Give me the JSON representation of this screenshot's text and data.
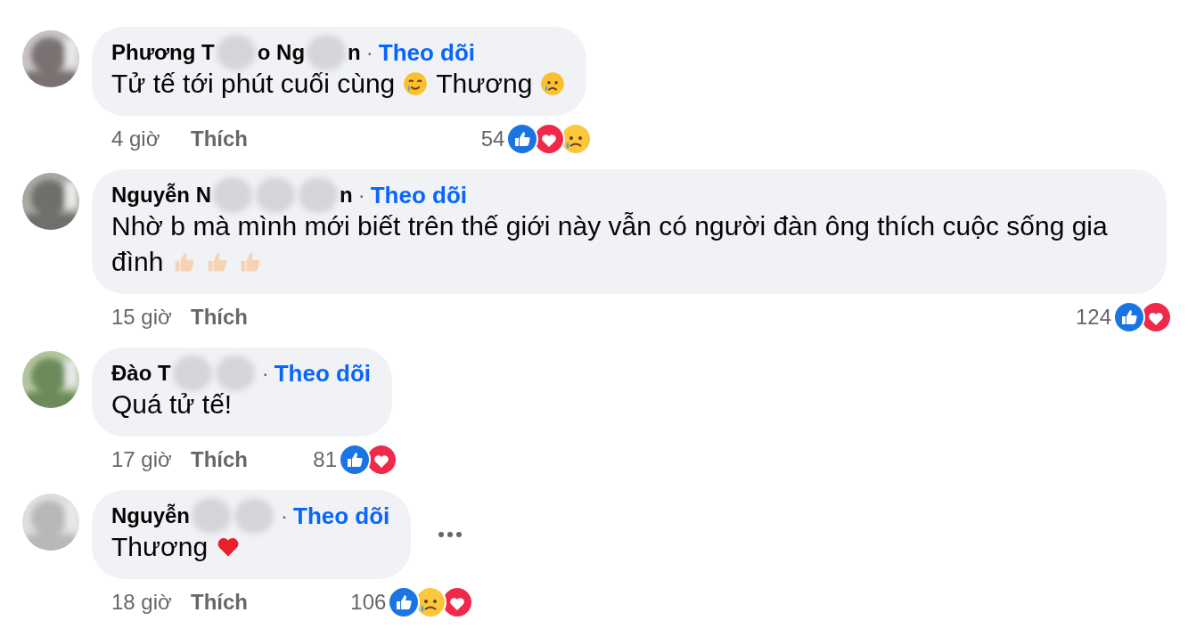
{
  "comments": [
    {
      "name": [
        {
          "kind": "text",
          "text": "Phương T"
        },
        {
          "kind": "blur"
        },
        {
          "kind": "text",
          "text": "o Ng"
        },
        {
          "kind": "blur"
        },
        {
          "kind": "text",
          "text": "n"
        }
      ],
      "separator": "·",
      "follow": "Theo dõi",
      "body": [
        {
          "kind": "text",
          "text": "Tử tế tới phút cuối cùng"
        },
        {
          "kind": "tear-smile"
        },
        {
          "kind": "text",
          "text": "Thương"
        },
        {
          "kind": "sad-tear"
        }
      ],
      "time": "4 giờ",
      "like": "Thích",
      "count": "54",
      "reactions": [
        {
          "kind": "like"
        },
        {
          "kind": "love"
        },
        {
          "kind": "sad"
        }
      ],
      "more": false
    },
    {
      "name": [
        {
          "kind": "text",
          "text": "Nguyễn N"
        },
        {
          "kind": "blur"
        },
        {
          "kind": "blur"
        },
        {
          "kind": "blur"
        },
        {
          "kind": "text",
          "text": "n"
        }
      ],
      "separator": "·",
      "follow": "Theo dõi",
      "body": [
        {
          "kind": "text",
          "text": "Nhờ b mà mình mới biết trên thế giới này vẫn có người đàn ông thích cuộc sống gia"
        },
        {
          "kind": "text",
          "text": "đình"
        },
        {
          "kind": "thumbs"
        },
        {
          "kind": "thumbs"
        },
        {
          "kind": "thumbs"
        }
      ],
      "time": "15 giờ",
      "like": "Thích",
      "count": "124",
      "reactions": [
        {
          "kind": "like"
        },
        {
          "kind": "love"
        }
      ],
      "more": false
    },
    {
      "name": [
        {
          "kind": "text",
          "text": "Đào T"
        },
        {
          "kind": "blur"
        },
        {
          "kind": "blur"
        }
      ],
      "separator": "·",
      "follow": "Theo dõi",
      "body": [
        {
          "kind": "text",
          "text": "Quá tử tế!"
        }
      ],
      "time": "17 giờ",
      "like": "Thích",
      "count": "81",
      "reactions": [
        {
          "kind": "like"
        },
        {
          "kind": "love"
        }
      ],
      "more": false
    },
    {
      "name": [
        {
          "kind": "text",
          "text": "Nguyễn"
        },
        {
          "kind": "blur"
        },
        {
          "kind": "blur"
        }
      ],
      "separator": "·",
      "follow": "Theo dõi",
      "body": [
        {
          "kind": "text",
          "text": "Thương"
        },
        {
          "kind": "heart"
        }
      ],
      "time": "18 giờ",
      "like": "Thích",
      "count": "106",
      "reactions": [
        {
          "kind": "like"
        },
        {
          "kind": "sad"
        },
        {
          "kind": "love"
        }
      ],
      "more": true
    }
  ]
}
